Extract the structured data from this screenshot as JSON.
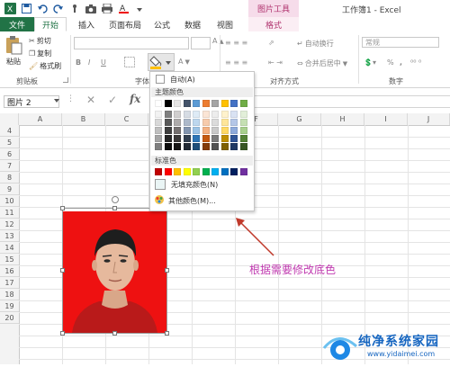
{
  "qat": {
    "icons": [
      "excel-logo-icon",
      "save-icon",
      "undo-icon",
      "redo-icon",
      "touch-mode-icon",
      "camera-icon",
      "print-icon",
      "font-color-icon",
      "customize-icon"
    ]
  },
  "titlebar": {
    "context_group": "图片工具",
    "window_title": "工作簿1 - Excel"
  },
  "tabs": {
    "file": "文件",
    "home": "开始",
    "insert": "插入",
    "layout": "页面布局",
    "formulas": "公式",
    "data": "数据",
    "view": "视图",
    "format": "格式"
  },
  "ribbon": {
    "clipboard": {
      "paste": "粘贴",
      "cut": "剪切",
      "copy": "复制",
      "format_painter": "格式刷",
      "group": "剪贴板"
    },
    "font": {
      "group": "字体",
      "bold": "B",
      "italic": "I",
      "underline": "U"
    },
    "alignment": {
      "wrap": "自动换行",
      "merge": "合并后居中",
      "group": "对齐方式"
    },
    "number": {
      "format": "常规",
      "group": "数字",
      "percent": "%",
      "comma": ","
    }
  },
  "formula_bar": {
    "name_box": "图片 2",
    "fx": "fx",
    "value": ""
  },
  "columns": [
    "A",
    "B",
    "C",
    "D",
    "E",
    "F",
    "G",
    "H",
    "I",
    "J"
  ],
  "rows": [
    "4",
    "5",
    "6",
    "7",
    "8",
    "9",
    "10",
    "11",
    "12",
    "13",
    "14",
    "15",
    "16",
    "17",
    "18",
    "19",
    "20"
  ],
  "dropdown": {
    "auto": "自动(A)",
    "theme_colors_label": "主题颜色",
    "standard_colors_label": "标准色",
    "no_fill": "无填充颜色(N)",
    "more_colors": "其他颜色(M)...",
    "theme_top": [
      "#ffffff",
      "#000000",
      "#e7e6e6",
      "#44546a",
      "#5b9bd5",
      "#ed7d31",
      "#a5a5a5",
      "#ffc000",
      "#4472c4",
      "#70ad47"
    ],
    "theme_shades": [
      [
        "#f2f2f2",
        "#7f7f7f",
        "#d0cece",
        "#d6dce4",
        "#deebf6",
        "#fbe5d5",
        "#ededed",
        "#fff2cc",
        "#d9e2f3",
        "#e2efd9"
      ],
      [
        "#d8d8d8",
        "#595959",
        "#aeabab",
        "#adb9ca",
        "#bdd7ee",
        "#f7cbac",
        "#dbdbdb",
        "#fee599",
        "#b4c6e7",
        "#c5e0b3"
      ],
      [
        "#bfbfbf",
        "#3f3f3f",
        "#757070",
        "#8496b0",
        "#9cc3e5",
        "#f4b183",
        "#c9c9c9",
        "#ffd965",
        "#8eaadb",
        "#a8d08d"
      ],
      [
        "#a5a5a5",
        "#262626",
        "#3a3838",
        "#323f4f",
        "#2e75b5",
        "#c55a11",
        "#7b7b7b",
        "#bf8f00",
        "#2f5496",
        "#538135"
      ],
      [
        "#7f7f7f",
        "#0c0c0c",
        "#171616",
        "#222a35",
        "#1e4e79",
        "#843c0b",
        "#525252",
        "#7f6000",
        "#1f3864",
        "#375623"
      ]
    ],
    "standard": [
      "#c00000",
      "#ff0000",
      "#ffc000",
      "#ffff00",
      "#92d050",
      "#00b050",
      "#00b0f0",
      "#0070c0",
      "#002060",
      "#7030a0"
    ]
  },
  "annotation": "根据需要修改底色",
  "photo": {
    "background": "#ee1111"
  },
  "watermark": {
    "title": "纯净系统家园",
    "url": "www.yidaimei.com"
  }
}
